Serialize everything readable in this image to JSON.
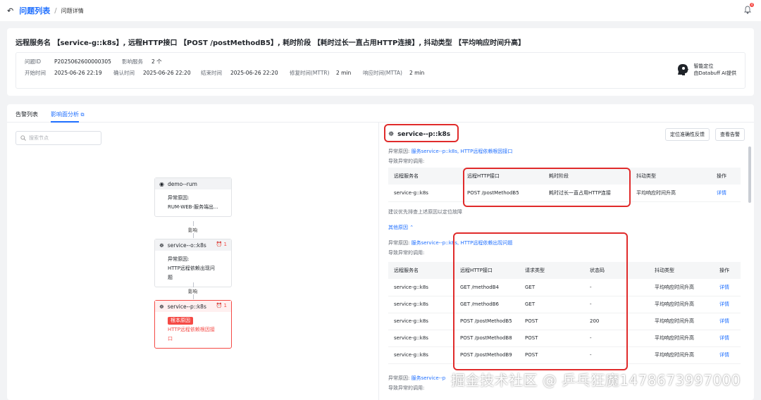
{
  "breadcrumb": {
    "parent": "问题列表",
    "separator": "/",
    "current": "问题详情"
  },
  "notifications": {
    "count": "4"
  },
  "issue": {
    "title": "远程服务名 【service-g::k8s】, 远程HTTP接口 【POST /postMethodB5】, 耗时阶段 【耗时过长一直占用HTTP连接】, 抖动类型 【平均响应时间升高】",
    "id_label": "问题ID",
    "id_value": "P2025062600000305",
    "affected_label": "影响服务",
    "affected_value": "2 个",
    "start_label": "开始时间",
    "start_value": "2025-06-26 22:19",
    "confirm_label": "确认时间",
    "confirm_value": "2025-06-26 22:20",
    "end_label": "结束时间",
    "end_value": "2025-06-26 22:20",
    "mttr_label": "修复时间(MTTR)",
    "mttr_value": "2 min",
    "mtta_label": "响应时间(MTTA)",
    "mtta_value": "2 min"
  },
  "ai": {
    "line1": "智能定位",
    "line2": "由Databuff AI提供"
  },
  "tabs": [
    {
      "label": "告警列表"
    },
    {
      "label": "影响面分析"
    }
  ],
  "search": {
    "placeholder": "搜索节点"
  },
  "graph": {
    "nodes": [
      {
        "name": "demo--rum",
        "reason_label": "异常原因:",
        "reason": "RUM-WEB-服务端出...",
        "alarms": ""
      },
      {
        "name": "service--o::k8s",
        "reason_label": "异常原因:",
        "reason": "HTTP远程依赖出现问题",
        "alarms": "1"
      },
      {
        "name": "service--p::k8s",
        "root_badge": "根本原因",
        "reason": "HTTP远程依赖根因接口",
        "alarms": "1"
      }
    ],
    "edge_label": "影响"
  },
  "detail": {
    "service": "service--p::k8s",
    "btn_feedback": "定位准确性反馈",
    "btn_alarms": "查看告警",
    "cause1_prefix": "异常原因:",
    "cause1_link": "服务service--p::k8s, HTTP远程依赖根因接口",
    "calls_label": "导致异常的调用:",
    "table1": {
      "headers": [
        "远程服务名",
        "远程HTTP接口",
        "耗时阶段",
        "抖动类型",
        "操作"
      ],
      "rows": [
        [
          "service-g::k8s",
          "POST /postMethodB5",
          "耗时过长一直占用HTTP连接",
          "平均响应时间升高",
          "详情"
        ]
      ]
    },
    "suggestion": "建议优先排查上述原因以定位故障",
    "other_causes": "其他原因",
    "cause2_prefix": "异常原因:",
    "cause2_link": "服务service--p::k8s, HTTP远程依赖出现问题",
    "table2": {
      "headers": [
        "远程服务名",
        "远程HTTP接口",
        "请求类型",
        "状态码",
        "抖动类型",
        "操作"
      ],
      "rows": [
        [
          "service-g::k8s",
          "GET /methodB4",
          "GET",
          "-",
          "平均响应时间升高",
          "详情"
        ],
        [
          "service-g::k8s",
          "GET /methodB6",
          "GET",
          "-",
          "平均响应时间升高",
          "详情"
        ],
        [
          "service-g::k8s",
          "POST /postMethodB5",
          "POST",
          "200",
          "平均响应时间升高",
          "详情"
        ],
        [
          "service-g::k8s",
          "POST /postMethodB8",
          "POST",
          "-",
          "平均响应时间升高",
          "详情"
        ],
        [
          "service-g::k8s",
          "POST /postMethodB9",
          "POST",
          "-",
          "平均响应时间升高",
          "详情"
        ]
      ]
    },
    "cause3_prefix": "异常原因:",
    "cause3_link": "服务service--p",
    "calls3_label": "导致异常的调用:"
  },
  "watermark": "掘金技术社区 @ 乒乓狂魔1478673997000"
}
